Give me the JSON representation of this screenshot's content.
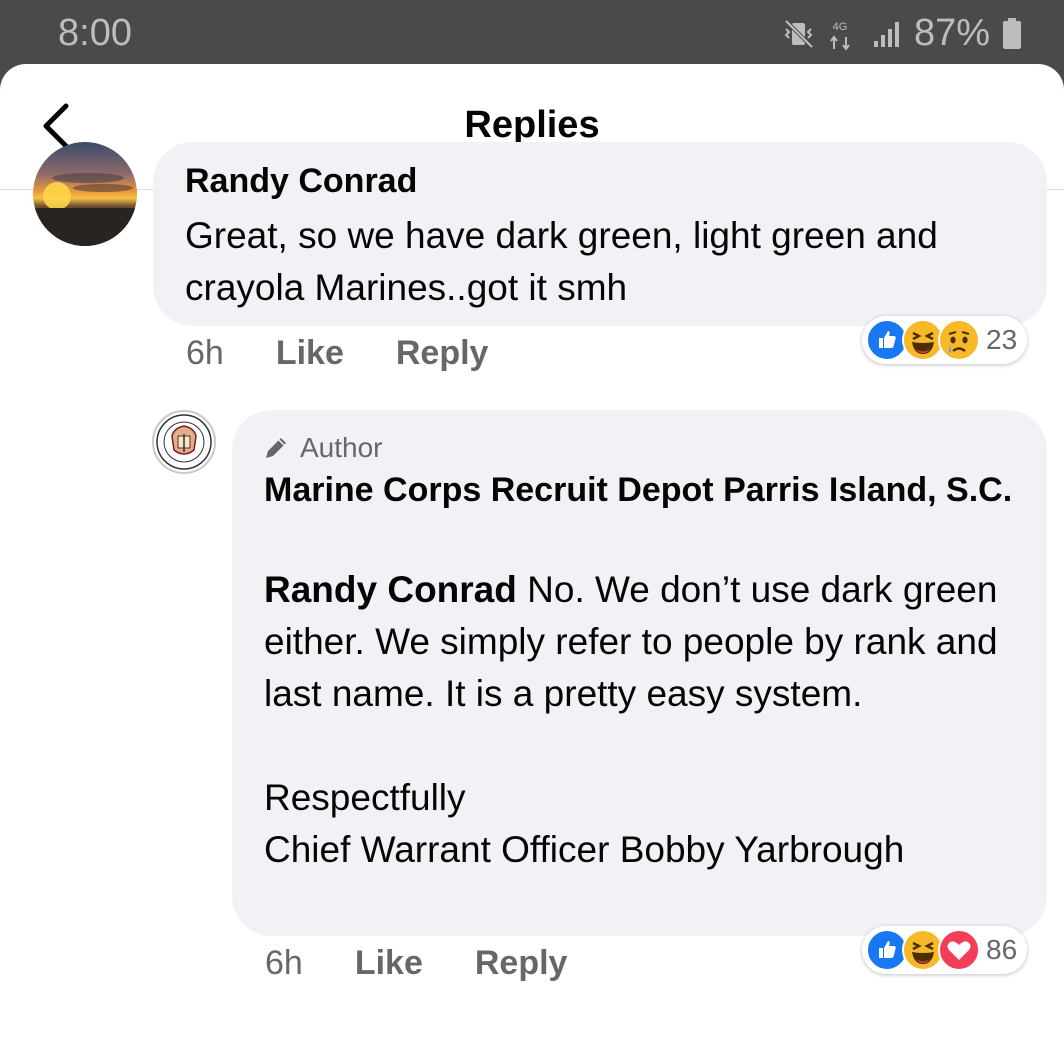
{
  "status_bar": {
    "time": "8:00",
    "network": "4G LTE",
    "battery": "87%"
  },
  "header": {
    "title": "Replies"
  },
  "comments": [
    {
      "author": "Randy Conrad",
      "text": "Great, so we have dark green, light green and crayola Marines..got it smh",
      "time": "6h",
      "like_label": "Like",
      "reply_label": "Reply",
      "reactions": [
        "like",
        "haha",
        "sad"
      ],
      "reaction_count": "23"
    },
    {
      "badge": "Author",
      "author": "Marine Corps Recruit Depot Parris Island, S.C.",
      "mention": "Randy Conrad",
      "text": "No. We don’t use dark green either. We simply refer to people by rank and last name. It is a pretty easy system.",
      "signoff_1": "Respectfully",
      "signoff_2": "Chief Warrant Officer Bobby Yarbrough",
      "time": "6h",
      "like_label": "Like",
      "reply_label": "Reply",
      "reactions": [
        "like",
        "haha",
        "love"
      ],
      "reaction_count": "86"
    }
  ],
  "colors": {
    "like_blue": "#1877f2",
    "haha_yellow": "#f7b928",
    "love_red": "#f33e58",
    "bubble_bg": "#f0f2f5",
    "meta_gray": "#65676b"
  },
  "icons": {
    "back": "chevron-left-icon",
    "author_badge": "pencil-icon",
    "status": [
      "vibrate-icon",
      "data-icon",
      "signal-icon",
      "battery-icon"
    ]
  }
}
